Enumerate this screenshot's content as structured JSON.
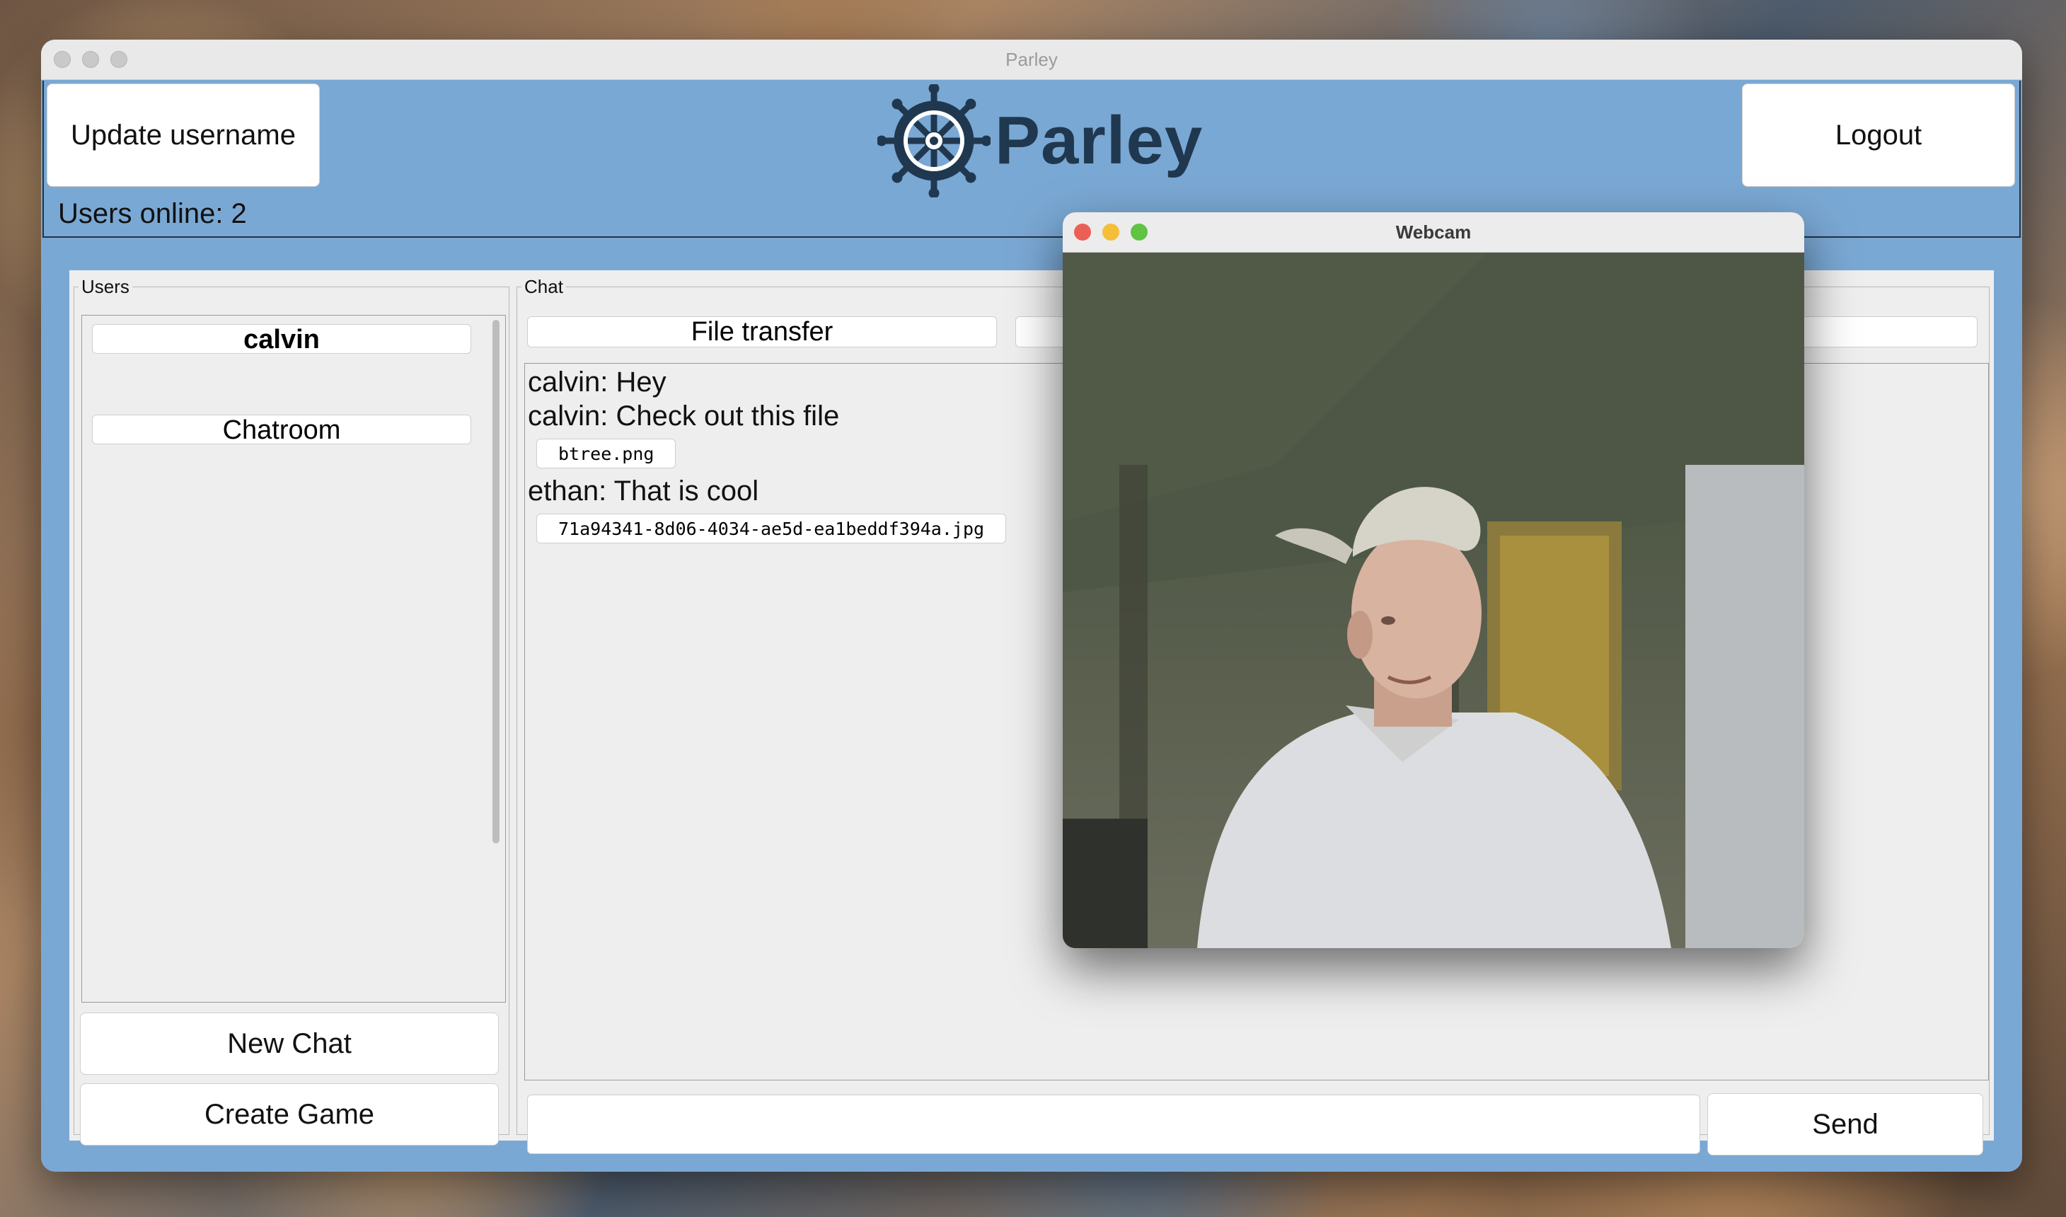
{
  "window": {
    "title": "Parley"
  },
  "header": {
    "update_username_label": "Update username",
    "logout_label": "Logout",
    "logo_text": "Parley",
    "users_online": "Users online: 2"
  },
  "users_panel": {
    "legend": "Users",
    "items": [
      {
        "label": "calvin"
      },
      {
        "label": "Chatroom"
      }
    ],
    "new_chat_label": "New Chat",
    "create_game_label": "Create Game"
  },
  "chat_panel": {
    "legend": "Chat",
    "tabs": [
      {
        "label": "File transfer"
      }
    ],
    "messages": [
      {
        "text": "calvin: Hey"
      },
      {
        "text": "calvin: Check out this file",
        "file": "btree.png"
      },
      {
        "text": "ethan: That is cool",
        "file": "71a94341-8d06-4034-ae5d-ea1beddf394a.jpg"
      }
    ],
    "input": {
      "value": "",
      "placeholder": ""
    },
    "send_label": "Send"
  },
  "webcam_window": {
    "title": "Webcam"
  },
  "colors": {
    "app_background": "#7aa8d4",
    "panel_background": "#eeeeee",
    "logo_color": "#20384f",
    "traffic_red": "#ec5f56",
    "traffic_yellow": "#f5be3a",
    "traffic_green": "#5fc343"
  }
}
